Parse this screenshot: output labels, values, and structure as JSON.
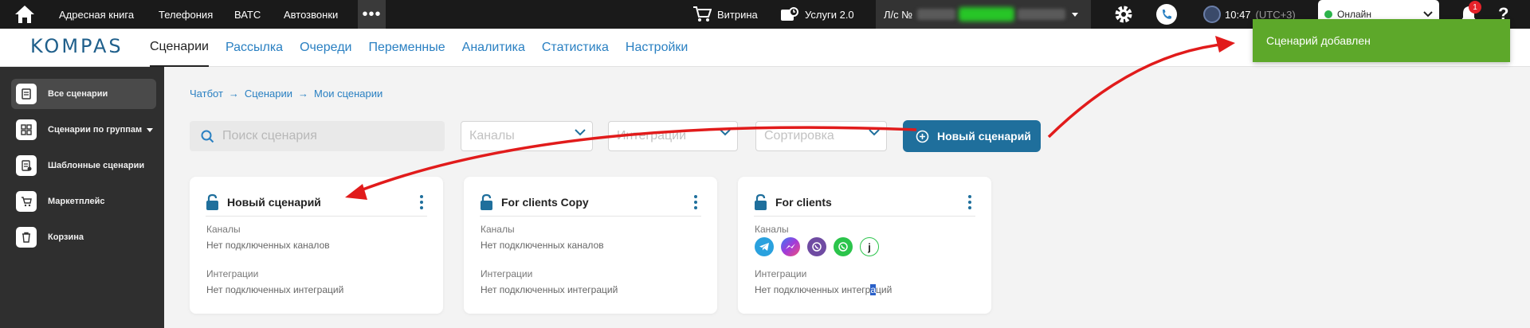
{
  "topbar": {
    "nav": [
      "Адресная книга",
      "Телефония",
      "ВАТС",
      "Автозвонки"
    ],
    "more_label": "•••",
    "showcase_label": "Витрина",
    "services_label": "Услуги 2.0",
    "account_prefix": "Л/с №",
    "time": "10:47",
    "timezone": "(UTC+3)",
    "status": "Онлайн",
    "notifications_count": "1",
    "help_label": "?"
  },
  "secnav": {
    "logo": "KOMPAS",
    "tabs": [
      "Сценарии",
      "Рассылка",
      "Очереди",
      "Переменные",
      "Аналитика",
      "Статистика",
      "Настройки"
    ]
  },
  "sidebar": {
    "items": [
      {
        "label": "Все сценарии",
        "icon": "list-icon"
      },
      {
        "label": "Сценарии по группам",
        "icon": "grid-icon"
      },
      {
        "label": "Шаблонные сценарии",
        "icon": "template-icon"
      },
      {
        "label": "Маркетплейс",
        "icon": "cart-icon"
      },
      {
        "label": "Корзина",
        "icon": "trash-icon"
      }
    ]
  },
  "breadcrumb": [
    "Чатбот",
    "Сценарии",
    "Мои сценарии"
  ],
  "search": {
    "placeholder": "Поиск сценария"
  },
  "filters": {
    "channels": "Каналы",
    "integrations": "Интеграции",
    "sort": "Сортировка"
  },
  "new_button": "Новый сценарий",
  "cards": [
    {
      "title": "Новый сценарий",
      "channels_label": "Каналы",
      "channels_value": "Нет подключенных каналов",
      "integrations_label": "Интеграции",
      "integrations_value": "Нет подключенных интеграций"
    },
    {
      "title": "For clients Copy",
      "channels_label": "Каналы",
      "channels_value": "Нет подключенных каналов",
      "integrations_label": "Интеграции",
      "integrations_value": "Нет подключенных интеграций"
    },
    {
      "title": "For clients",
      "channels_label": "Каналы",
      "integrations_label": "Интеграции",
      "integrations_value_a": "Нет подключенных интегр",
      "integrations_value_b": "а",
      "integrations_value_c": "ций",
      "channel_icons": [
        "telegram-icon",
        "messenger-icon",
        "viber-icon",
        "whatsapp-icon",
        "jivo-icon"
      ]
    }
  ],
  "toast": "Сценарий добавлен",
  "colors": {
    "accent": "#1f6f9c",
    "link": "#2a80c2",
    "toast": "#5da82a",
    "annotation": "#e11b1b"
  }
}
